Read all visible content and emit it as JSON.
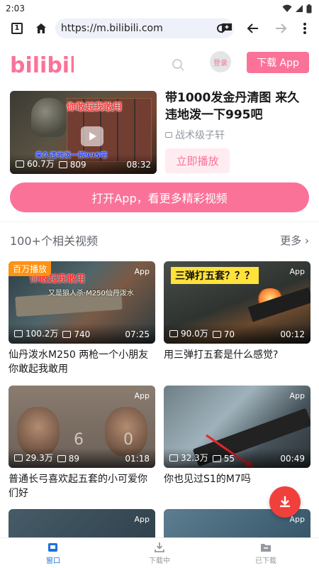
{
  "status_bar": {
    "time": "2:03"
  },
  "browser": {
    "tab_count": "1",
    "url": "https://m.bilibili.com"
  },
  "header": {
    "logo_text": "bilibili",
    "login_label": "登录",
    "download_label": "下载 App"
  },
  "featured": {
    "title": "带1000发金丹清图 来久违地泼一下995吧",
    "author": "战术级子轩",
    "views": "60.7万",
    "comments": "809",
    "duration": "08:32",
    "play_label": "立即播放",
    "overlay_red": "你敢起我敢用",
    "overlay_blue": "来久违地泼一把995吧"
  },
  "open_app_label": "打开App，看更多精彩视频",
  "related": {
    "title": "100+个相关视频",
    "more_label": "更多",
    "videos": [
      {
        "title": "仙丹泼水M250 两枪一个小朋友 你敢起我敢用",
        "views": "100.2万",
        "comments": "740",
        "duration": "07:25",
        "badge": "App",
        "hot": "百万播放",
        "overlay": "你敢起我敢用",
        "overlay2": "又是狼人杀·M250仙丹泼水"
      },
      {
        "title": "用三弹打五套是什么感觉?",
        "views": "90.0万",
        "comments": "70",
        "duration": "00:12",
        "badge": "App",
        "overlay": "三弹打五套？？？"
      },
      {
        "title": "普通长弓喜欢起五套的小可爱你们好",
        "views": "29.3万",
        "comments": "89",
        "duration": "01:18",
        "badge": "App",
        "digit_left": "6",
        "digit_right": "0"
      },
      {
        "title": "你也见过S1的M7吗",
        "views": "32.3万",
        "comments": "55",
        "duration": "00:49",
        "badge": "App"
      },
      {
        "title": "",
        "views": "",
        "comments": "",
        "duration": "",
        "badge": "App"
      },
      {
        "title": "",
        "views": "",
        "comments": "",
        "duration": "",
        "badge": "App"
      }
    ]
  },
  "bottom_nav": {
    "items": [
      {
        "label": "窗口"
      },
      {
        "label": "下载中"
      },
      {
        "label": "已下载"
      }
    ]
  },
  "colors": {
    "brand_pink": "#fb7299",
    "fab_red": "#f1403c",
    "active_blue": "#1e6fd9"
  }
}
